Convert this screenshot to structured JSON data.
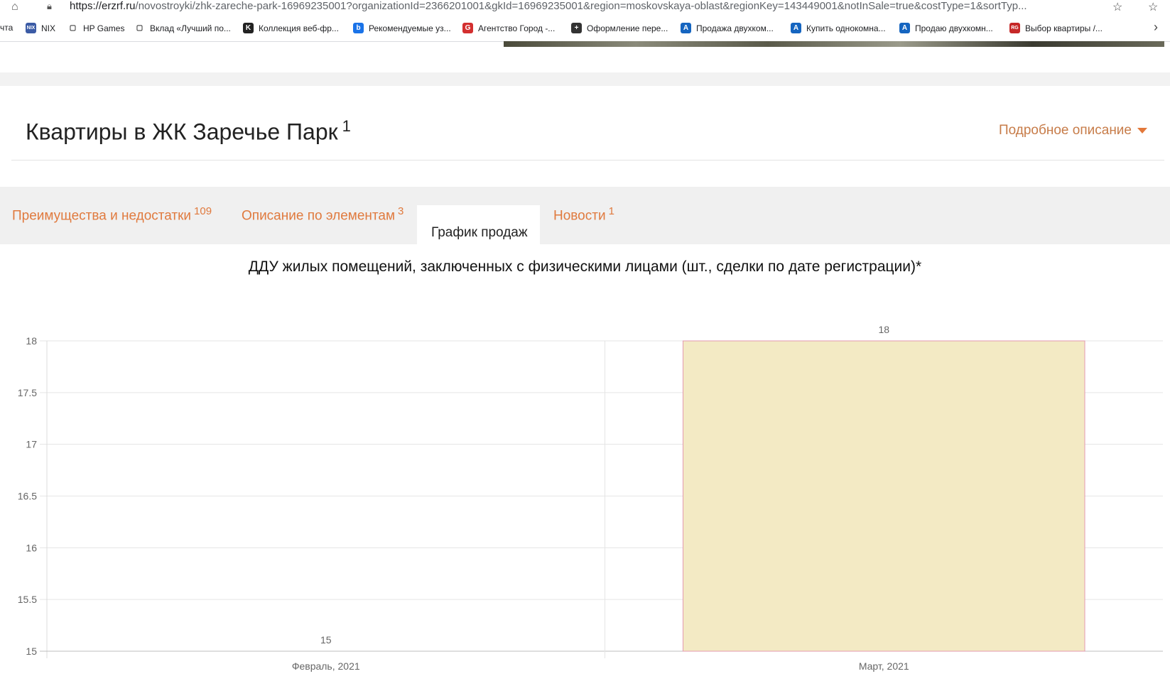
{
  "browser": {
    "url_host": "https://erzrf.ru",
    "url_path": "/novostroyki/zhk-zareche-park-16969235001?organizationId=2366201001&gkId=16969235001&region=moskovskaya-oblast&regionKey=143449001&notInSale=true&costType=1&sortTyp..."
  },
  "bookmarks": [
    {
      "label": "чта",
      "icon_text": "",
      "color": "#ffffff"
    },
    {
      "label": "NIX",
      "icon_text": "NIX",
      "color": "#3b5ba5"
    },
    {
      "label": "HP Games",
      "icon_text": "▢",
      "color": "#ffffff"
    },
    {
      "label": "Вклад «Лучший по...",
      "icon_text": "▢",
      "color": "#ffffff"
    },
    {
      "label": "Коллекция веб-фр...",
      "icon_text": "K",
      "color": "#222222"
    },
    {
      "label": "Рекомендуемые уз...",
      "icon_text": "b",
      "color": "#1a73e8"
    },
    {
      "label": "Агентство Город -...",
      "icon_text": "G",
      "color": "#d32f2f"
    },
    {
      "label": "Оформление пере...",
      "icon_text": "+",
      "color": "#333333"
    },
    {
      "label": "Продажа двухком...",
      "icon_text": "A",
      "color": "#1565c0"
    },
    {
      "label": "Купить однокомна...",
      "icon_text": "A",
      "color": "#1565c0"
    },
    {
      "label": "Продаю двухкомн...",
      "icon_text": "A",
      "color": "#1565c0"
    },
    {
      "label": "Выбор квартиры /...",
      "icon_text": "RG",
      "color": "#c62828"
    }
  ],
  "header": {
    "title": "Квартиры в ЖК Заречье Парк",
    "title_count": "1",
    "details_link": "Подробное описание"
  },
  "tabs": [
    {
      "label": "Преимущества и недостатки",
      "count": "109"
    },
    {
      "label": "Описание по элементам",
      "count": "3"
    },
    {
      "label": "График продаж",
      "count": ""
    },
    {
      "label": "Новости",
      "count": "1"
    }
  ],
  "colors": {
    "accent": "#e07a3e",
    "bar_fill": "#f3eac4",
    "bar_stroke": "#e39ab0"
  },
  "chart_data": {
    "type": "bar",
    "title": "ДДУ жилых помещений, заключенных с физическими лицами (шт., сделки по дате регистрации)*",
    "categories": [
      "Февраль, 2021",
      "Март, 2021"
    ],
    "values": [
      15,
      18
    ],
    "data_labels": [
      "15",
      "18"
    ],
    "ylim": [
      15,
      18
    ],
    "yticks": [
      "15",
      "15.5",
      "16",
      "16.5",
      "17",
      "17.5",
      "18"
    ],
    "grid": true,
    "xlabel": "",
    "ylabel": ""
  }
}
